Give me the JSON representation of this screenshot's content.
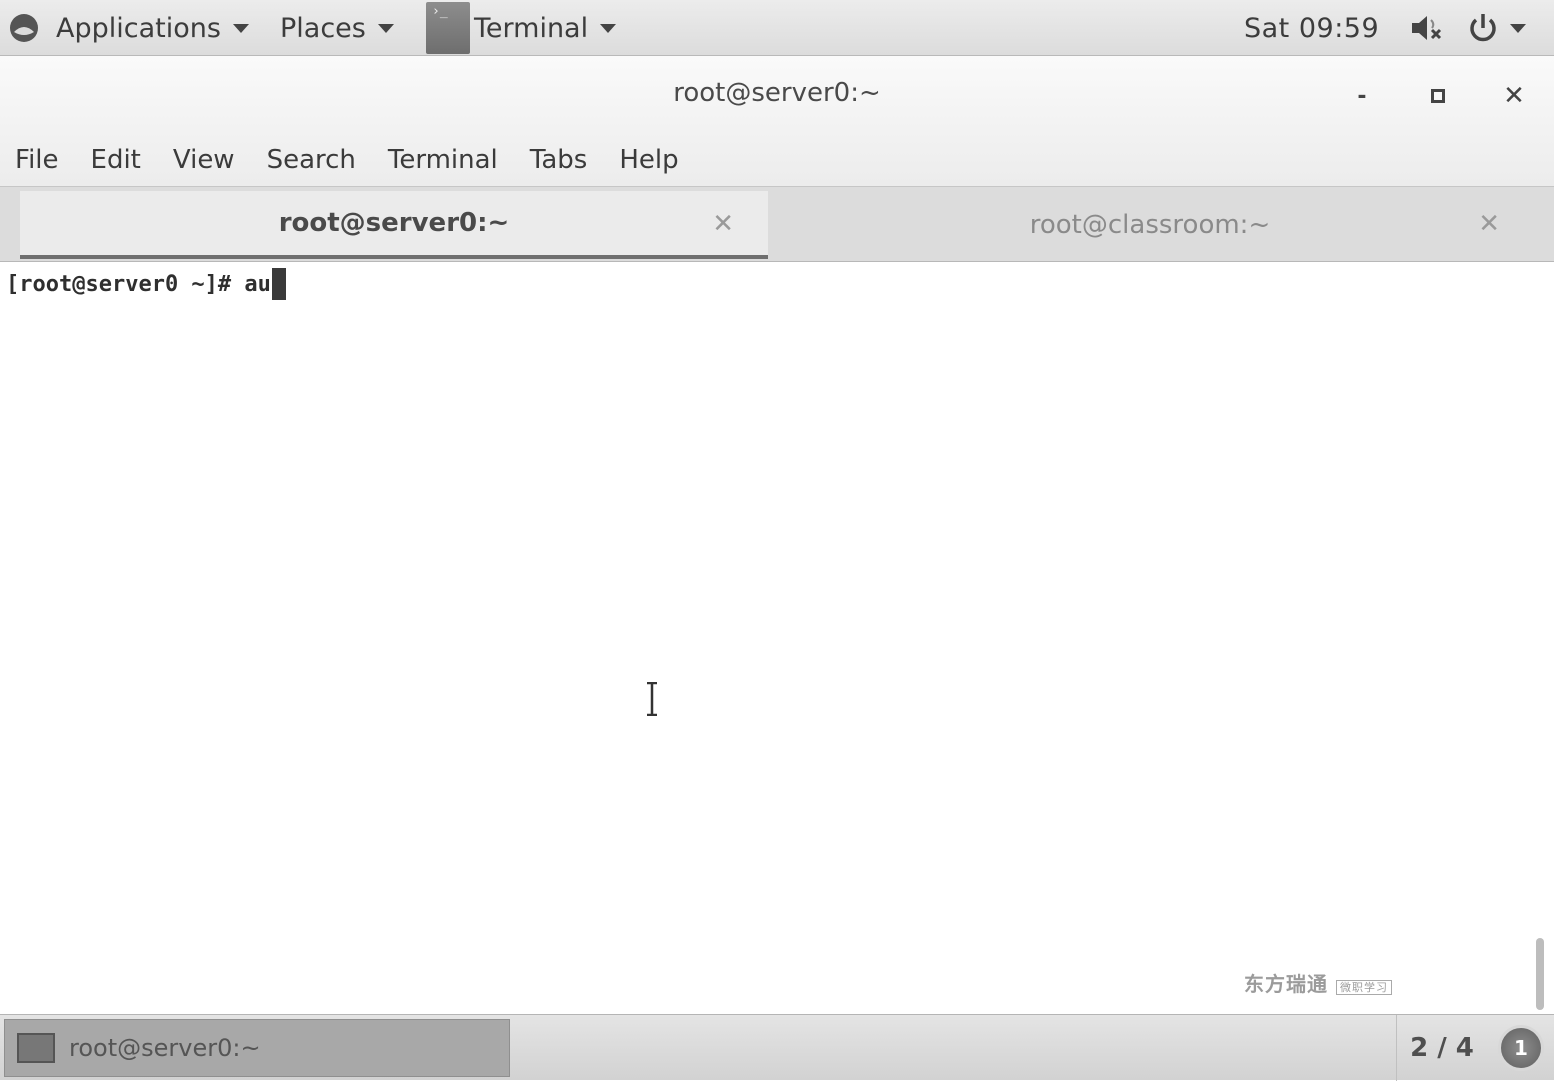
{
  "top_panel": {
    "applications_label": "Applications",
    "places_label": "Places",
    "active_app_label": "Terminal",
    "clock": "Sat 09:59",
    "volume_icon": "volume-muted-icon",
    "power_icon": "power-icon"
  },
  "window": {
    "title": "root@server0:~",
    "min_label": "-",
    "max_label": "■",
    "close_label": "✕"
  },
  "menubar": {
    "items": [
      {
        "label": "File"
      },
      {
        "label": "Edit"
      },
      {
        "label": "View"
      },
      {
        "label": "Search"
      },
      {
        "label": "Terminal"
      },
      {
        "label": "Tabs"
      },
      {
        "label": "Help"
      }
    ]
  },
  "tabs": [
    {
      "label": "root@server0:~",
      "active": true
    },
    {
      "label": "root@classroom:~",
      "active": false
    }
  ],
  "terminal": {
    "prompt": "[root@server0 ~]# ",
    "input": "au"
  },
  "watermark": {
    "text": "东方瑞通",
    "sub": "微职学习"
  },
  "bottom_panel": {
    "task_label": "root@server0:~",
    "workspace": "2 / 4",
    "notification_count": "1"
  },
  "colors": {
    "panel_bg": "#dcdcdc",
    "terminal_bg": "#ffffff",
    "text": "#3a3a3a"
  }
}
